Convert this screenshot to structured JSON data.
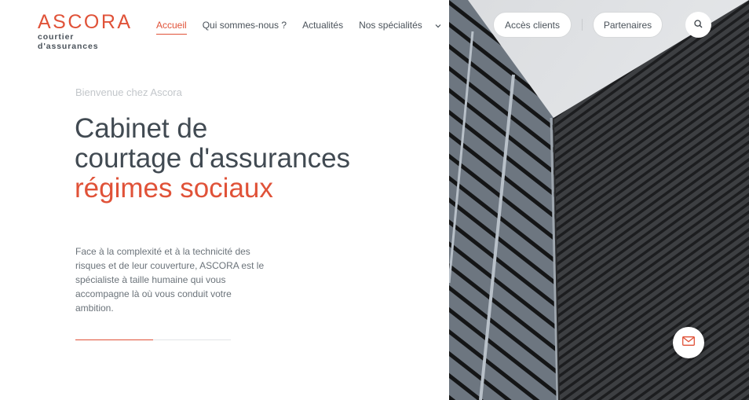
{
  "logo": {
    "name": "ASCORA",
    "tagline": "courtier d'assurances"
  },
  "nav": {
    "items": [
      {
        "label": "Accueil",
        "active": true
      },
      {
        "label": "Qui sommes-nous ?",
        "active": false
      },
      {
        "label": "Actualités",
        "active": false
      },
      {
        "label": "Nos spécialités",
        "active": false,
        "icon": "chevron-down-icon"
      }
    ]
  },
  "header_actions": {
    "client_access_label": "Accès clients",
    "partners_label": "Partenaires",
    "search_icon": "search-icon"
  },
  "hero": {
    "eyebrow": "Bienvenue chez Ascora",
    "headline_line1": "Cabinet de",
    "headline_line2": "courtage d'assurances",
    "headline_line3": "régimes sociaux",
    "intro": "Face à la complexité et à la technicité des risques et de leur couverture, ASCORA est le spécialiste à taille humaine qui vous accompagne là où vous conduit votre ambition."
  },
  "slider": {
    "progress": 0.5
  },
  "contact": {
    "icon": "mail-icon"
  },
  "colors": {
    "accent": "#e05238",
    "text_dark": "#414a52",
    "text_muted": "#c3c7cb"
  }
}
